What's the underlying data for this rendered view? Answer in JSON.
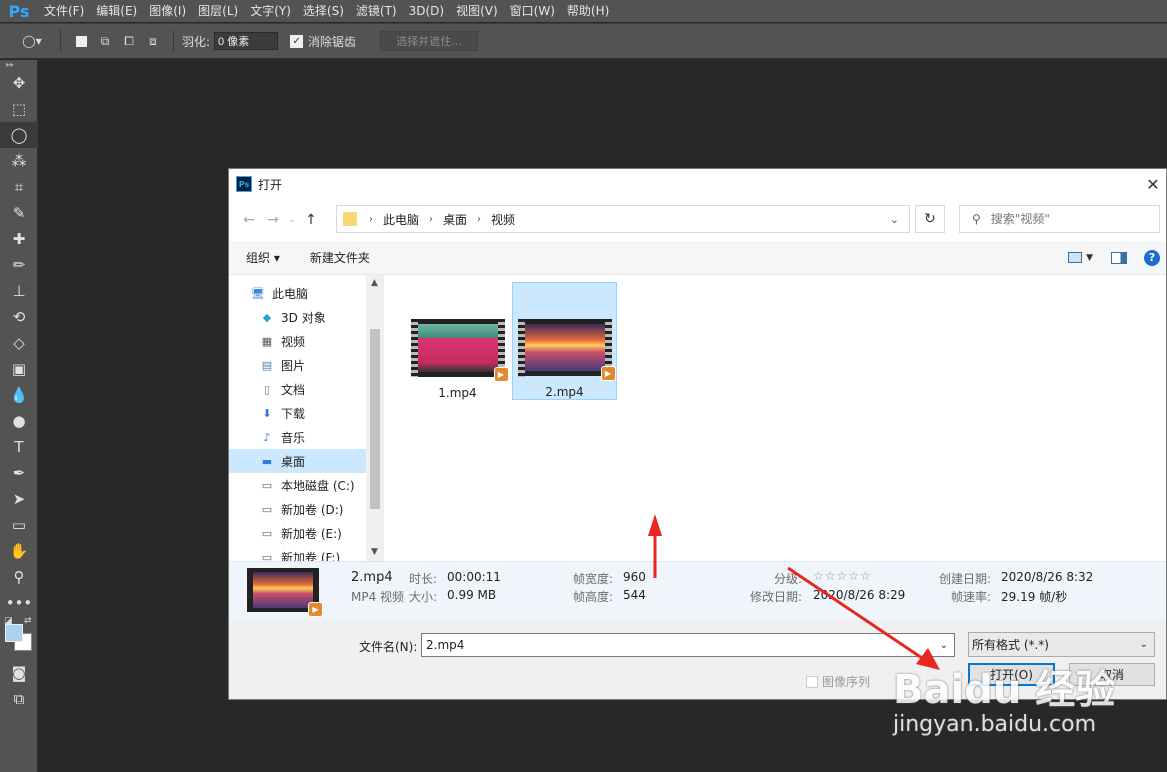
{
  "menubar": {
    "logo": "Ps",
    "items": [
      "文件(F)",
      "编辑(E)",
      "图像(I)",
      "图层(L)",
      "文字(Y)",
      "选择(S)",
      "滤镜(T)",
      "3D(D)",
      "视图(V)",
      "窗口(W)",
      "帮助(H)"
    ]
  },
  "options": {
    "feather_label": "羽化:",
    "feather_value": "0 像素",
    "antialias_label": "消除锯齿",
    "select_mask": "选择并遮住..."
  },
  "dialog": {
    "title": "打开",
    "breadcrumb": [
      "此电脑",
      "桌面",
      "视频"
    ],
    "search_placeholder": "搜索\"视频\"",
    "cmd_organize": "组织 ▾",
    "cmd_new_folder": "新建文件夹",
    "nav_items": [
      {
        "label": "此电脑",
        "icon": "computer-icon"
      },
      {
        "label": "3D 对象",
        "icon": "cube-icon"
      },
      {
        "label": "视频",
        "icon": "film-icon"
      },
      {
        "label": "图片",
        "icon": "picture-icon"
      },
      {
        "label": "文档",
        "icon": "document-icon"
      },
      {
        "label": "下载",
        "icon": "download-icon"
      },
      {
        "label": "音乐",
        "icon": "music-icon"
      },
      {
        "label": "桌面",
        "icon": "desktop-icon"
      },
      {
        "label": "本地磁盘 (C:)",
        "icon": "drive-icon"
      },
      {
        "label": "新加卷 (D:)",
        "icon": "drive-icon"
      },
      {
        "label": "新加卷 (E:)",
        "icon": "drive-icon"
      },
      {
        "label": "新加卷 (F:)",
        "icon": "drive-icon"
      }
    ],
    "files": [
      {
        "name": "1.mp4"
      },
      {
        "name": "2.mp4"
      }
    ],
    "details": {
      "name": "2.mp4",
      "type": "MP4 视频",
      "duration_label": "时长:",
      "duration": "00:00:11",
      "size_label": "大小:",
      "size": "0.99 MB",
      "width_label": "帧宽度:",
      "width": "960",
      "height_label": "帧高度:",
      "height": "544",
      "rating_label": "分级:",
      "rating": "☆☆☆☆☆",
      "modified_label": "修改日期:",
      "modified": "2020/8/26 8:29",
      "created_label": "创建日期:",
      "created": "2020/8/26 8:32",
      "fps_label": "帧速率:",
      "fps": "29.19 帧/秒"
    },
    "filename_label": "文件名(N):",
    "filename_value": "2.mp4",
    "filter_value": "所有格式 (*.*)",
    "image_sequence": "图像序列",
    "open_button": "打开(O)",
    "cancel_button": "取消"
  },
  "watermark": {
    "logo": "Baidu 经验",
    "url": "jingyan.baidu.com"
  },
  "colors": {
    "accent_selection": "#cce8ff",
    "annotation_arrow": "#e8281e",
    "ps_blue": "#31a8ff"
  }
}
